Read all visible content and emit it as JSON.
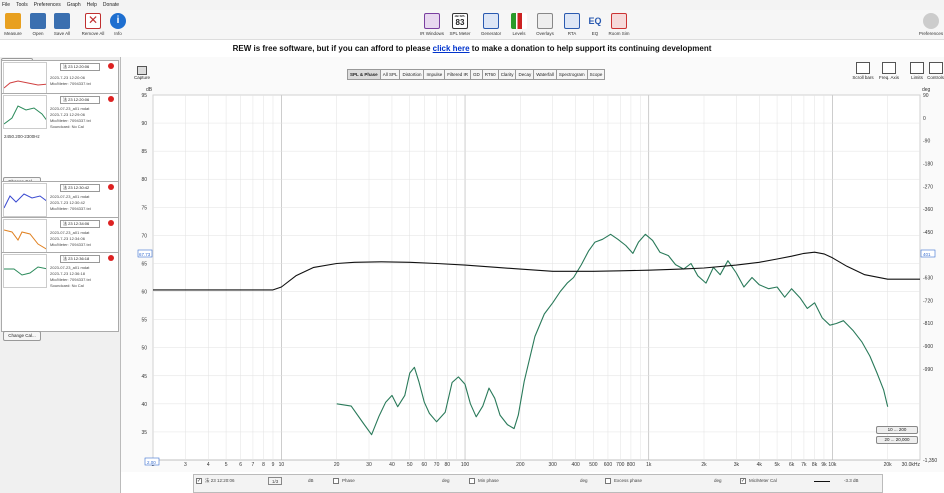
{
  "menu": [
    "File",
    "Tools",
    "Preferences",
    "Graph",
    "Help",
    "Donate"
  ],
  "toolbar_left": [
    {
      "label": "Measure",
      "icon": "measure-icon",
      "color": "#e8a020"
    },
    {
      "label": "Open",
      "icon": "folder-icon",
      "color": "#3a6fb0"
    },
    {
      "label": "Save All",
      "icon": "save-icon",
      "color": "#3a6fb0"
    },
    {
      "label": "Remove All",
      "icon": "remove-icon",
      "color": "#c03030"
    },
    {
      "label": "Info",
      "icon": "info-icon",
      "color": "#1e6fd0"
    }
  ],
  "toolbar_center": [
    {
      "label": "IR Windows",
      "icon": "ir-windows-icon",
      "color": "#7a3fa0"
    },
    {
      "label": "SPL Meter",
      "icon": "spl-meter-icon",
      "color": "#333333",
      "value": "83",
      "unit": "dB SPL"
    },
    {
      "label": "Generator",
      "icon": "generator-icon",
      "color": "#2a5ab0"
    },
    {
      "label": "Levels",
      "icon": "levels-icon",
      "color": "#cc2222"
    },
    {
      "label": "Overlays",
      "icon": "overlays-icon",
      "color": "#888888"
    },
    {
      "label": "RTA",
      "icon": "rta-icon",
      "color": "#2a5ab0"
    },
    {
      "label": "EQ",
      "icon": "eq-icon",
      "color": "#2a5ab0",
      "text": "EQ"
    },
    {
      "label": "Room Sim",
      "icon": "room-sim-icon",
      "color": "#cc3333"
    }
  ],
  "toolbar_right": {
    "label": "Preferences",
    "icon": "preferences-icon"
  },
  "banner": {
    "prefix": "REW is free software, but if you can afford to please ",
    "link": "click here",
    "suffix": " to make a donation to help support its continuing development"
  },
  "left_panel": {
    "collapse_label": "Collapse",
    "measurements": [
      {
        "title": "法 23 12:20:06",
        "lines": [
          "",
          "2023-7-23 12:20:06",
          "Mic/Meter: 7094337.txt"
        ],
        "thumb_color": "#d04040"
      },
      {
        "title": "法 23 12:20:06",
        "lines": [
          "2023-07-23_a01 mdat",
          "2023-7-23 12:29:06",
          "Mic/Meter: 7094337.txt",
          "Soundcard: No Cal"
        ],
        "thumb_color": "#2a8a5a",
        "notes": "2450.200-2300Hz",
        "change_cal": "Change Cal..."
      },
      {
        "title": "法 23 12:30:42",
        "lines": [
          "2023-07-23_a01 mdat",
          "2023-7-23 12:30:42",
          "Mic/Meter: 7094337.txt"
        ],
        "thumb_color": "#3a4ad0"
      },
      {
        "title": "法 23 12:34:06",
        "lines": [
          "2023-07-23_a01 mdat",
          "2023-7-23 12:34:06",
          "Mic/Meter: 7094337.txt"
        ],
        "thumb_color": "#e08020"
      },
      {
        "title": "法 23 12:36:18",
        "lines": [
          "2023-07-23_a01 mdat",
          "2023-7-23 12:36:18",
          "Mic/Meter: 7094337.txt",
          "Soundcard: No Cal"
        ],
        "thumb_color": "#2a8a5a",
        "change_cal": "Change Cal..."
      }
    ]
  },
  "capture_label": "Capture",
  "graph_tabs": [
    "SPL & Phase",
    "All SPL",
    "Distortion",
    "Impulse",
    "Filtered IR",
    "GD",
    "RT60",
    "Clarity",
    "Decay",
    "Waterfall",
    "Spectrogram",
    "Scope"
  ],
  "active_tab": "SPL & Phase",
  "right_tools": [
    {
      "label": "Scroll bars",
      "icon": "scrollbars-icon"
    },
    {
      "label": "Freq. Axis",
      "icon": "freq-axis-icon"
    },
    {
      "label": "Limits",
      "icon": "limits-icon"
    },
    {
      "label": "Controls",
      "icon": "controls-icon"
    }
  ],
  "chart_data": {
    "type": "line",
    "xscale": "log",
    "xlim": [
      2,
      30000
    ],
    "ylim": [
      30,
      95
    ],
    "y_right_lim": [
      -1350,
      90
    ],
    "y_unit": "dB",
    "y_right_unit": "deg",
    "x_ticks": [
      "2",
      "3",
      "4",
      "5",
      "6",
      "7",
      "8",
      "9",
      "10",
      "20",
      "30",
      "40",
      "50",
      "60",
      "70",
      "80",
      "100",
      "200",
      "300",
      "400",
      "500",
      "600",
      "700",
      "800",
      "1k",
      "2k",
      "3k",
      "4k",
      "5k",
      "6k",
      "7k",
      "8k",
      "9k",
      "10k",
      "20k",
      "30.0kHz"
    ],
    "x_tick_values": [
      2,
      3,
      4,
      5,
      6,
      7,
      8,
      9,
      10,
      20,
      30,
      40,
      50,
      60,
      70,
      80,
      100,
      200,
      300,
      400,
      500,
      600,
      700,
      800,
      1000,
      2000,
      3000,
      4000,
      5000,
      6000,
      7000,
      8000,
      9000,
      10000,
      20000,
      30000
    ],
    "y_ticks": [
      35,
      40,
      45,
      50,
      55,
      60,
      65,
      70,
      75,
      80,
      85,
      90,
      95
    ],
    "y_right_ticks": [
      "-1,350",
      "-990",
      "-900",
      "-810",
      "-720",
      "-630",
      "-540",
      "-450",
      "-360",
      "-270",
      "-180",
      "-90",
      "0",
      "90"
    ],
    "y_right_tick_values": [
      -1350,
      -990,
      -900,
      -810,
      -720,
      -630,
      -540,
      -450,
      -360,
      -270,
      -180,
      -90,
      0,
      90
    ],
    "left_marker": "67.73",
    "right_marker": "401",
    "left_axis_top": "dB",
    "right_axis_top": "deg",
    "x_start_label": "2.00",
    "grid": true,
    "series": [
      {
        "color": "#2a7a5a",
        "points": [
          [
            20,
            40
          ],
          [
            24,
            39.6
          ],
          [
            28,
            36.5
          ],
          [
            31,
            34.5
          ],
          [
            34,
            37.8
          ],
          [
            37,
            40.3
          ],
          [
            40,
            41.5
          ],
          [
            43,
            39.5
          ],
          [
            47,
            41.5
          ],
          [
            50,
            45.5
          ],
          [
            53,
            46.5
          ],
          [
            56,
            44
          ],
          [
            60,
            40.3
          ],
          [
            64,
            38.3
          ],
          [
            70,
            36.8
          ],
          [
            78,
            38.5
          ],
          [
            85,
            43.8
          ],
          [
            92,
            44.8
          ],
          [
            100,
            43.5
          ],
          [
            107,
            40
          ],
          [
            115,
            37.7
          ],
          [
            125,
            39.6
          ],
          [
            135,
            42.8
          ],
          [
            145,
            41
          ],
          [
            155,
            38
          ],
          [
            170,
            36.3
          ],
          [
            185,
            35.6
          ],
          [
            195,
            38
          ],
          [
            210,
            44
          ],
          [
            240,
            52
          ],
          [
            270,
            56
          ],
          [
            300,
            58
          ],
          [
            330,
            60
          ],
          [
            360,
            61.5
          ],
          [
            390,
            62.5
          ],
          [
            430,
            64.8
          ],
          [
            470,
            67.2
          ],
          [
            510,
            68.8
          ],
          [
            560,
            69.3
          ],
          [
            620,
            70.2
          ],
          [
            680,
            69.3
          ],
          [
            750,
            68.2
          ],
          [
            820,
            66.8
          ],
          [
            880,
            68.8
          ],
          [
            960,
            70.2
          ],
          [
            1050,
            69.1
          ],
          [
            1150,
            67
          ],
          [
            1280,
            66.4
          ],
          [
            1400,
            64.8
          ],
          [
            1550,
            64
          ],
          [
            1700,
            65
          ],
          [
            1850,
            62.8
          ],
          [
            2050,
            61.5
          ],
          [
            2250,
            64.3
          ],
          [
            2450,
            63
          ],
          [
            2700,
            65.5
          ],
          [
            3000,
            63.3
          ],
          [
            3300,
            60.8
          ],
          [
            3650,
            62.5
          ],
          [
            4000,
            61.2
          ],
          [
            4500,
            60.5
          ],
          [
            5000,
            60.8
          ],
          [
            5500,
            59
          ],
          [
            6000,
            60.5
          ],
          [
            6700,
            58.8
          ],
          [
            7300,
            57
          ],
          [
            8000,
            58
          ],
          [
            8800,
            55.3
          ],
          [
            9700,
            54
          ],
          [
            10500,
            54.3
          ],
          [
            11500,
            54.8
          ],
          [
            13000,
            53
          ],
          [
            14500,
            51
          ],
          [
            16000,
            48.5
          ],
          [
            17500,
            45.5
          ],
          [
            19000,
            42.5
          ],
          [
            20000,
            39.5
          ]
        ]
      },
      {
        "color": "#111111",
        "points": [
          [
            2,
            60.3
          ],
          [
            9,
            60.3
          ],
          [
            10,
            60.8
          ],
          [
            12,
            62.8
          ],
          [
            15,
            64.3
          ],
          [
            20,
            65
          ],
          [
            25,
            65.2
          ],
          [
            35,
            65.3
          ],
          [
            50,
            65.2
          ],
          [
            70,
            65
          ],
          [
            100,
            64.7
          ],
          [
            150,
            64.3
          ],
          [
            200,
            64
          ],
          [
            300,
            63.6
          ],
          [
            500,
            63.6
          ],
          [
            700,
            63.7
          ],
          [
            1000,
            63.8
          ],
          [
            1500,
            64
          ],
          [
            2000,
            64.2
          ],
          [
            3000,
            64.7
          ],
          [
            4000,
            65.2
          ],
          [
            5000,
            65.8
          ],
          [
            6000,
            66.3
          ],
          [
            7000,
            66.8
          ],
          [
            8000,
            67
          ],
          [
            9000,
            66.7
          ],
          [
            10000,
            66
          ],
          [
            12000,
            64.5
          ],
          [
            15000,
            63
          ],
          [
            20000,
            62.2
          ],
          [
            30000,
            62.2
          ]
        ]
      }
    ]
  },
  "range_buttons": [
    "10 ... 200",
    "20 ... 20,000"
  ],
  "bottom_bar": {
    "meas_name": "法 23 12:20:06",
    "db_label": "dB",
    "phase_label": "Phase",
    "deg_label": "deg",
    "mphase_label": "Min phase",
    "deg2_label": "deg",
    "excess_label": "Excess phase",
    "deg3_label": "deg",
    "miccal_label": "Mic/Meter Cal",
    "miccal_value": "-3.3 dB",
    "dollar": "$"
  }
}
